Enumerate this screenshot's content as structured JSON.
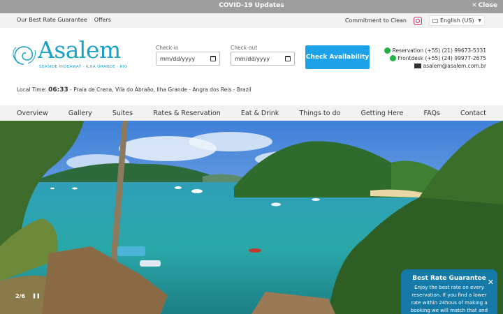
{
  "covid": {
    "title": "COVID-19 Updates",
    "close_label": "Close"
  },
  "utility": {
    "links": [
      "Our Best Rate Guarantee",
      "Offers"
    ],
    "commitment": "Commitment to Clean",
    "language": "English (US)"
  },
  "logo": {
    "name": "Asalem",
    "tagline": "SEASIDE HIDEAWAY · ILHA GRANDE · RIO"
  },
  "booking": {
    "checkin_label": "Check-in",
    "checkout_label": "Check-out",
    "checkin_value": "mm/dd/yyyy",
    "checkout_value": "mm/dd/yyyy",
    "button_label": "Check Availability"
  },
  "contact": {
    "reservation": "Reservation (+55) (21) 99673-5331",
    "frontdesk": "Frontdesk (+55) (24) 99977-2675",
    "email": "asalem@asalem.com.br"
  },
  "local_time": {
    "label": "Local Time:",
    "time": "06:33",
    "location": "- Praia de Crena, Vila do Abraão, Ilha Grande - Angra dos Reis - Brazil"
  },
  "nav": [
    "Overview",
    "Gallery",
    "Suites",
    "Rates & Reservation",
    "Eat & Drink",
    "Things to do",
    "Getting Here",
    "FAQs",
    "Contact"
  ],
  "slider": {
    "counter": "2/6"
  },
  "best_rate": {
    "title": "Best Rate Guarantee",
    "text": "Enjoy the best rate on every reservation. If you find a lower rate within 24hous of making a booking we will match that and even give you an"
  },
  "colors": {
    "brand": "#1da1c8",
    "button": "#1da1e8",
    "popup": "#167aa8"
  }
}
